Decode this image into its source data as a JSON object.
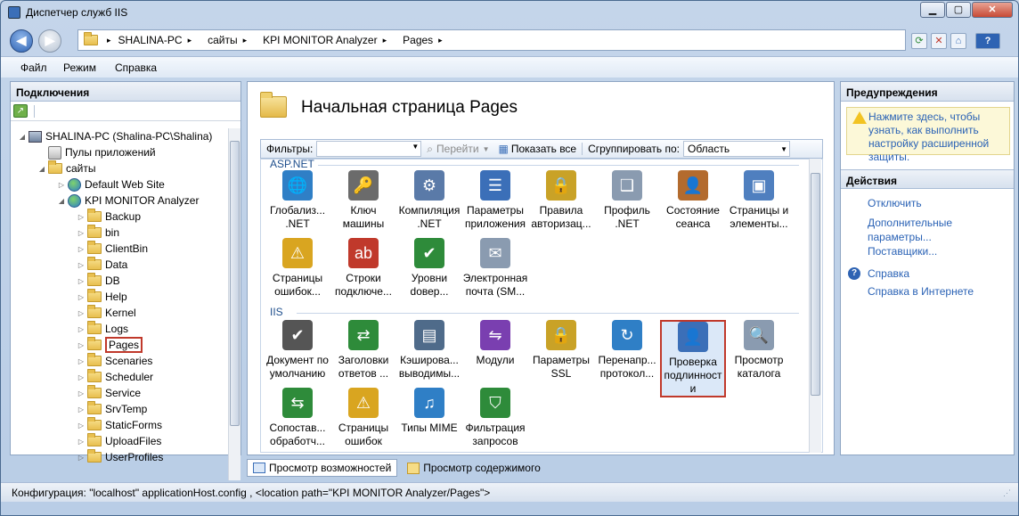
{
  "window": {
    "title": "Диспетчер служб IIS",
    "min": "▁",
    "max": "▢",
    "close": "✕"
  },
  "address": {
    "back": "◀",
    "forward": "▶",
    "crumbs": [
      "SHALINA-PC",
      "сайты",
      "KPI MONITOR Analyzer",
      "Pages"
    ],
    "sep": "▸",
    "help": "?"
  },
  "menu": [
    "Файл",
    "Режим",
    "Справка"
  ],
  "connections": {
    "title": "Подключения",
    "tree": [
      {
        "label": "SHALINA-PC (Shalina-PC\\Shalina)",
        "icon": "pc-icon",
        "exp": "◢"
      },
      {
        "label": "Пулы приложений",
        "icon": "app-pool-icon",
        "exp": ""
      },
      {
        "label": "сайты",
        "icon": "folder-icon",
        "exp": "◢"
      },
      {
        "label": "Default Web Site",
        "icon": "globe-icon",
        "exp": "▷"
      },
      {
        "label": "KPI MONITOR Analyzer",
        "icon": "globe-icon",
        "exp": "◢"
      },
      {
        "label": "Backup",
        "icon": "folder-icon",
        "exp": "▷"
      },
      {
        "label": "bin",
        "icon": "folder-icon",
        "exp": "▷"
      },
      {
        "label": "ClientBin",
        "icon": "folder-icon",
        "exp": "▷"
      },
      {
        "label": "Data",
        "icon": "folder-icon",
        "exp": "▷"
      },
      {
        "label": "DB",
        "icon": "folder-icon",
        "exp": "▷"
      },
      {
        "label": "Help",
        "icon": "folder-icon",
        "exp": "▷"
      },
      {
        "label": "Kernel",
        "icon": "folder-icon",
        "exp": "▷"
      },
      {
        "label": "Logs",
        "icon": "folder-icon",
        "exp": "▷"
      },
      {
        "label": "Pages",
        "icon": "folder-icon",
        "exp": "▷"
      },
      {
        "label": "Scenaries",
        "icon": "folder-icon",
        "exp": "▷"
      },
      {
        "label": "Scheduler",
        "icon": "folder-icon",
        "exp": "▷"
      },
      {
        "label": "Service",
        "icon": "folder-icon",
        "exp": "▷"
      },
      {
        "label": "SrvTemp",
        "icon": "folder-icon",
        "exp": "▷"
      },
      {
        "label": "StaticForms",
        "icon": "folder-icon",
        "exp": "▷"
      },
      {
        "label": "UploadFiles",
        "icon": "folder-icon",
        "exp": "▷"
      },
      {
        "label": "UserProfiles",
        "icon": "folder-icon",
        "exp": "▷"
      }
    ]
  },
  "center": {
    "title": "Начальная страница Pages",
    "filter_label": "Фильтры:",
    "go_label": "Перейти",
    "show_all_label": "Показать все",
    "group_label": "Сгруппировать по:",
    "group_value": "Область",
    "groups": {
      "aspnet": "ASP.NET",
      "iis": "IIS"
    },
    "aspnet_features": [
      {
        "label": "Глобализ...\n.NET",
        "icon": "globalization-icon",
        "color": "#2f7fc6",
        "glyph": "🌐"
      },
      {
        "label": "Ключ\nмашины",
        "icon": "machine-key-icon",
        "color": "#6b6b6b",
        "glyph": "🔑"
      },
      {
        "label": "Компиляция\n.NET",
        "icon": "compilation-icon",
        "color": "#5a7aa8",
        "glyph": "⚙"
      },
      {
        "label": "Параметры\nприложения",
        "icon": "app-settings-icon",
        "color": "#3b6fb8",
        "glyph": "☰"
      },
      {
        "label": "Правила\nавторизац...",
        "icon": "authorization-rules-icon",
        "color": "#c9a227",
        "glyph": "🔒"
      },
      {
        "label": "Профиль\n.NET",
        "icon": "profile-icon",
        "color": "#8a9bb0",
        "glyph": "❑"
      },
      {
        "label": "Состояние\nсеанса",
        "icon": "session-state-icon",
        "color": "#b36b2e",
        "glyph": "👤"
      },
      {
        "label": "Страницы и\nэлементы...",
        "icon": "pages-controls-icon",
        "color": "#4f7fbf",
        "glyph": "▣"
      },
      {
        "label": "Страницы\nошибок...",
        "icon": "error-pages-icon",
        "color": "#d9a520",
        "glyph": "⚠"
      },
      {
        "label": "Строки\nподключе...",
        "icon": "connection-strings-icon",
        "color": "#c0392b",
        "glyph": "ab"
      },
      {
        "label": "Уровни\ndовер...",
        "icon": "trust-levels-icon",
        "color": "#2e8b3a",
        "glyph": "✔"
      },
      {
        "label": "Электронная\nпочта (SM...",
        "icon": "smtp-email-icon",
        "color": "#8a9bb0",
        "glyph": "✉"
      }
    ],
    "iis_features": [
      {
        "label": "Документ по\nумолчанию",
        "icon": "default-document-icon",
        "color": "#555",
        "glyph": "✔"
      },
      {
        "label": "Заголовки\nответов ...",
        "icon": "response-headers-icon",
        "color": "#2e8b3a",
        "glyph": "⇄"
      },
      {
        "label": "Кэширова...\nвыводимы...",
        "icon": "output-caching-icon",
        "color": "#4f6b8a",
        "glyph": "▤"
      },
      {
        "label": "Модули",
        "icon": "modules-icon",
        "color": "#7a3fb0",
        "glyph": "⇋"
      },
      {
        "label": "Параметры\nSSL",
        "icon": "ssl-settings-icon",
        "color": "#c9a227",
        "glyph": "🔒"
      },
      {
        "label": "Перенапр...\nпротокол...",
        "icon": "http-redirect-icon",
        "color": "#2f7fc6",
        "glyph": "↻"
      },
      {
        "label": "Проверка\nподлинност\nи",
        "icon": "authentication-icon",
        "color": "#3b6fb8",
        "glyph": "👤",
        "selected": true
      },
      {
        "label": "Просмотр\nкаталога",
        "icon": "directory-browsing-icon",
        "color": "#8a9bb0",
        "glyph": "🔍"
      },
      {
        "label": "Сопостав...\nобработч...",
        "icon": "handler-mappings-icon",
        "color": "#2e8b3a",
        "glyph": "⇆"
      },
      {
        "label": "Страницы\nошибок",
        "icon": "error-pages-icon",
        "color": "#d9a520",
        "glyph": "⚠"
      },
      {
        "label": "Типы MIME",
        "icon": "mime-types-icon",
        "color": "#2f7fc6",
        "glyph": "♫"
      },
      {
        "label": "Фильтрация\nзапросов",
        "icon": "request-filtering-icon",
        "color": "#2e8b3a",
        "glyph": "⛉"
      }
    ],
    "tabs": [
      "Просмотр возможностей",
      "Просмотр содержимого"
    ]
  },
  "actions": {
    "alerts_title": "Предупреждения",
    "alert_text": "Нажмите здесь, чтобы узнать, как выполнить настройку расширенной защиты.",
    "actions_title": "Действия",
    "disable": "Отключить",
    "advanced": "Дополнительные параметры...",
    "providers": "Поставщики...",
    "help": "Справка",
    "online_help": "Справка в Интернете"
  },
  "status": {
    "text": "Конфигурация: \"localhost\" applicationHost.config , <location path=\"KPI MONITOR Analyzer/Pages\">"
  }
}
